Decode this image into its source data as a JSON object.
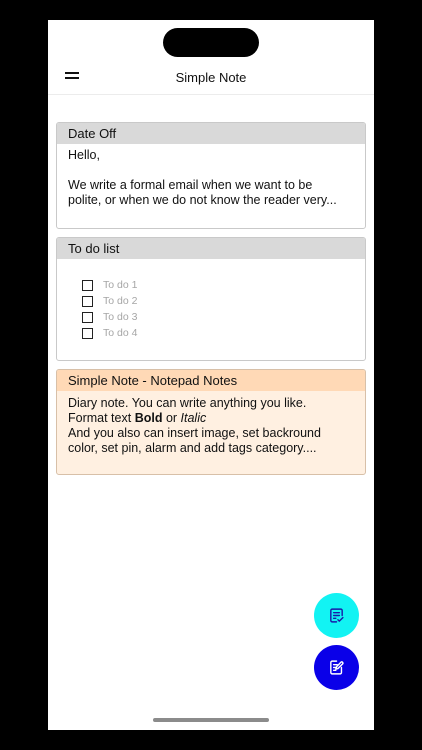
{
  "app": {
    "title": "Simple Note"
  },
  "icons": {
    "menu": "hamburger-menu-icon",
    "checklist": "checklist-note-icon",
    "edit": "edit-note-icon"
  },
  "colors": {
    "checklist_fab": "#12f3f3",
    "note_fab": "#0a00e8",
    "note3_header": "#ffd9b6",
    "note3_background": "#fff0e1"
  },
  "notes": [
    {
      "title": "Date Off",
      "lines": [
        "Hello,",
        "",
        "We write a formal email when we want to be",
        "polite, or when we do not know the reader very..."
      ]
    },
    {
      "title": "To do list",
      "todos": [
        "To do 1",
        "To do 2",
        "To do 3",
        "To do 4"
      ]
    },
    {
      "title": "Simple Note - Notepad Notes",
      "line1": "Diary note. You can write anything you like.",
      "line2_prefix": "Format text ",
      "line2_bold": "Bold",
      "line2_mid": " or ",
      "line2_italic": "Italic",
      "line3": "And you also can insert image, set backround",
      "line4": "color, set pin, alarm and add tags category...."
    }
  ]
}
